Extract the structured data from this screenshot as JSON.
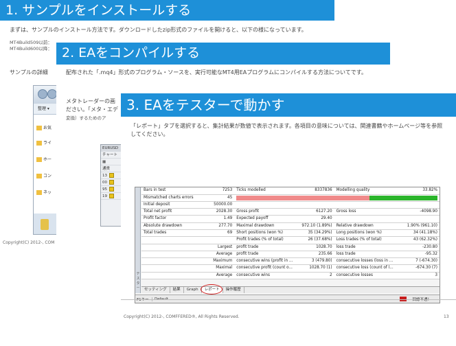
{
  "slide1": {
    "title": "1. サンプルをインストールする",
    "intro": "まずは、サンプルのインストール方法です。ダウンロードしたzip形式のファイルを開けると、以下の様になっています。",
    "build1": "MT4Build509以前：",
    "build2": "MT4Build600以降：",
    "sample_line": "サンプルの詳細",
    "explorer": {
      "toolbar": "整理 ▾",
      "items": [
        "お気",
        "ライ",
        "ホー",
        "コン",
        "ネッ"
      ]
    },
    "copyright": "Copyright(C) 2012-, COM"
  },
  "slide2": {
    "title": "2. EAをコンパイルする",
    "para1": "配布された「.mq4」形式のプログラム・ソースを、実行可能なMT4用EAプログラムにコンパイルする方法についてです。",
    "para2a": "メタトレーダーの画",
    "para2b": "ださい。「メタ・エデ",
    "para2c": "変換）するためのア",
    "mt4": {
      "title": "EURUSD",
      "menu": "チャート",
      "header": "通貨",
      "rows": [
        "13",
        "00",
        "95",
        "19"
      ]
    }
  },
  "slide3": {
    "title": "3. EAをテスターで動かす",
    "body": "「レポート」タブを選択すると、集計結果が数値で表示されます。各項目の意味については、関連書籍やホームページ等を参照してください。",
    "report": {
      "bars_in_test_label": "Bars in test",
      "bars_in_test": "7253",
      "ticks_label": "Ticks modelled",
      "ticks": "8337836",
      "quality_label": "Modelling quality",
      "quality": "33.82%",
      "quality_fraction": 0.3382,
      "mismatch_label": "Mismatched charts errors",
      "mismatch": "45",
      "deposit_label": "Initial deposit",
      "deposit": "50000.00",
      "net_label": "Total net profit",
      "net": "2028.30",
      "gross_profit_label": "Gross profit",
      "gross_profit": "6127.20",
      "gross_loss_label": "Gross loss",
      "gross_loss": "-4098.90",
      "pf_label": "Profit factor",
      "pf": "1.49",
      "expected_label": "Expected payoff",
      "expected": "29.40",
      "abs_dd_label": "Absolute drawdown",
      "abs_dd": "277.70",
      "max_dd_label": "Maximal drawdown",
      "max_dd": "972.10 (1.89%)",
      "rel_dd_label": "Relative drawdown",
      "rel_dd": "1.90% (961.10)",
      "trades_label": "Total trades",
      "trades": "69",
      "short_label": "Short positions (won %)",
      "short": "35 (34.29%)",
      "long_label": "Long positions (won %)",
      "long": "34 (41.18%)",
      "pt_label": "Profit trades (% of total)",
      "pt": "26 (37.68%)",
      "lt_label": "Loss trades (% of total)",
      "lt": "43 (62.32%)",
      "largest_label": "Largest",
      "largest_profit_label": "profit trade",
      "largest_profit": "1028.70",
      "largest_loss_label": "loss trade",
      "largest_loss": "-230.80",
      "average_label": "Average",
      "avg_profit_label": "profit trade",
      "avg_profit": "235.66",
      "avg_loss_label": "loss trade",
      "avg_loss": "-95.32",
      "maximum_label": "Maximum",
      "cwins_label": "consecutive wins (profit in ...",
      "cwins": "3 (479.80)",
      "closses_label": "consecutive losses (loss in ...",
      "closses": "7 (-674.30)",
      "maximal_label": "Maximal",
      "cprofit_label": "consecutive profit (count o...",
      "cprofit": "1028.70 (1)",
      "closs_label": "consecutive loss (count of l...",
      "closs": "-674.30 (7)",
      "average2_label": "Average",
      "avg_cwins_label": "consecutive wins",
      "avg_cwins": "2",
      "avg_closses_label": "consecutive losses",
      "avg_closses": "3"
    },
    "tabs": [
      "セッティング",
      "結果",
      "Graph",
      "レポート",
      "操作履歴"
    ],
    "sideband": "テスター",
    "status": {
      "help": "F1キー",
      "profile": "Default",
      "connection": "回線不通！"
    }
  },
  "footer": {
    "copyright": "Copyright(C) 2012-, COMFFERED®, All Rights Reserved.",
    "page": "13"
  },
  "colors": {
    "accent": "#1e90d8",
    "quality_bad": "#f08a8a",
    "quality_good": "#2bb52b"
  }
}
